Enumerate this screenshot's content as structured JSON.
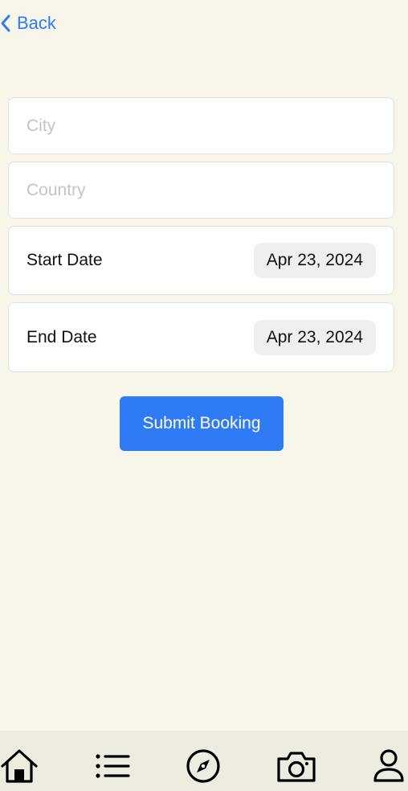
{
  "nav": {
    "back_label": "Back"
  },
  "form": {
    "city_placeholder": "City",
    "country_placeholder": "Country",
    "start_date_label": "Start Date",
    "start_date_value": "Apr 23, 2024",
    "end_date_label": "End Date",
    "end_date_value": "Apr 23, 2024",
    "submit_label": "Submit Booking"
  },
  "tabbar": {
    "items": [
      "home-icon",
      "list-icon",
      "compass-icon",
      "camera-icon",
      "person-icon"
    ]
  },
  "colors": {
    "accent": "#2f7bf5",
    "background": "#f8f5ea",
    "tabbar_bg": "#eeece1"
  }
}
